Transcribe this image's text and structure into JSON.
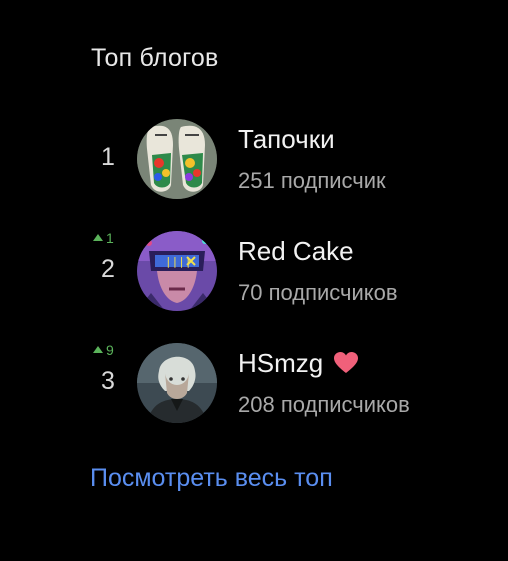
{
  "widget": {
    "title": "Топ блогов",
    "see_all_link": "Посмотреть весь топ"
  },
  "blogs": [
    {
      "rank": "1",
      "rank_change": "",
      "name": "Тапочки",
      "subscribers": "251 подписчик",
      "avatar_icon": "slippers-avatar",
      "badge": ""
    },
    {
      "rank": "2",
      "rank_change": "1",
      "name": "Red Cake",
      "subscribers": "70 подписчиков",
      "avatar_icon": "cyberpunk-avatar",
      "badge": ""
    },
    {
      "rank": "3",
      "rank_change": "9",
      "name": "HSmzg",
      "subscribers": "208 подписчиков",
      "avatar_icon": "portrait-avatar",
      "badge": "heart-icon"
    }
  ],
  "colors": {
    "background": "#000000",
    "link": "#5a8ef0",
    "rank_up": "#5bb35b",
    "heart": "#f0607a"
  }
}
